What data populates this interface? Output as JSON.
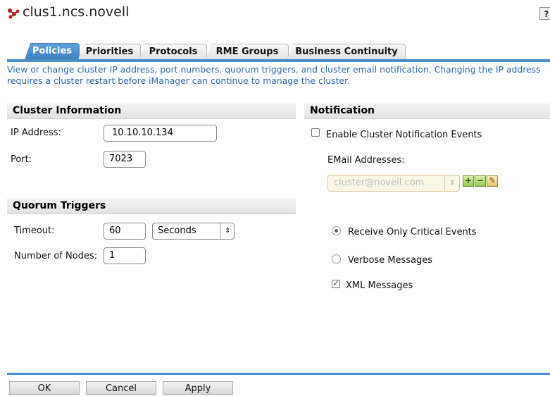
{
  "header": {
    "title": "clus1.ncs.novell",
    "help_label": "?"
  },
  "tabs": [
    {
      "label": "Policies"
    },
    {
      "label": "Priorities"
    },
    {
      "label": "Protocols"
    },
    {
      "label": "RME Groups"
    },
    {
      "label": "Business Continuity"
    }
  ],
  "description": "View or change cluster IP address, port numbers, quorum triggers, and cluster email notification. Changing the IP address requires a cluster restart before iManager can continue to manage the cluster.",
  "cluster_info": {
    "title": "Cluster Information",
    "ip_label": "IP Address:",
    "ip_value": "10.10.10.134",
    "port_label": "Port:",
    "port_value": "7023"
  },
  "quorum": {
    "title": "Quorum Triggers",
    "timeout_label": "Timeout:",
    "timeout_value": "60",
    "timeout_unit": "Seconds",
    "nodes_label": "Number of Nodes:",
    "nodes_value": "1"
  },
  "notification": {
    "title": "Notification",
    "enable_label": "Enable Cluster Notification Events",
    "enable_checked": false,
    "email_label": "EMail Addresses:",
    "email_value": "cluster@novell.com",
    "radio_critical": "Receive Only Critical Events",
    "radio_verbose": "Verbose Messages",
    "xml_label": "XML Messages",
    "xml_checked": true
  },
  "buttons": {
    "ok": "OK",
    "cancel": "Cancel",
    "apply": "Apply"
  },
  "icons": {
    "cluster": "cluster-icon",
    "add": "add-icon",
    "remove": "remove-icon",
    "edit": "edit-icon"
  },
  "colors": {
    "accent": "#4a8fc8",
    "description_text": "#2d6aa3"
  }
}
